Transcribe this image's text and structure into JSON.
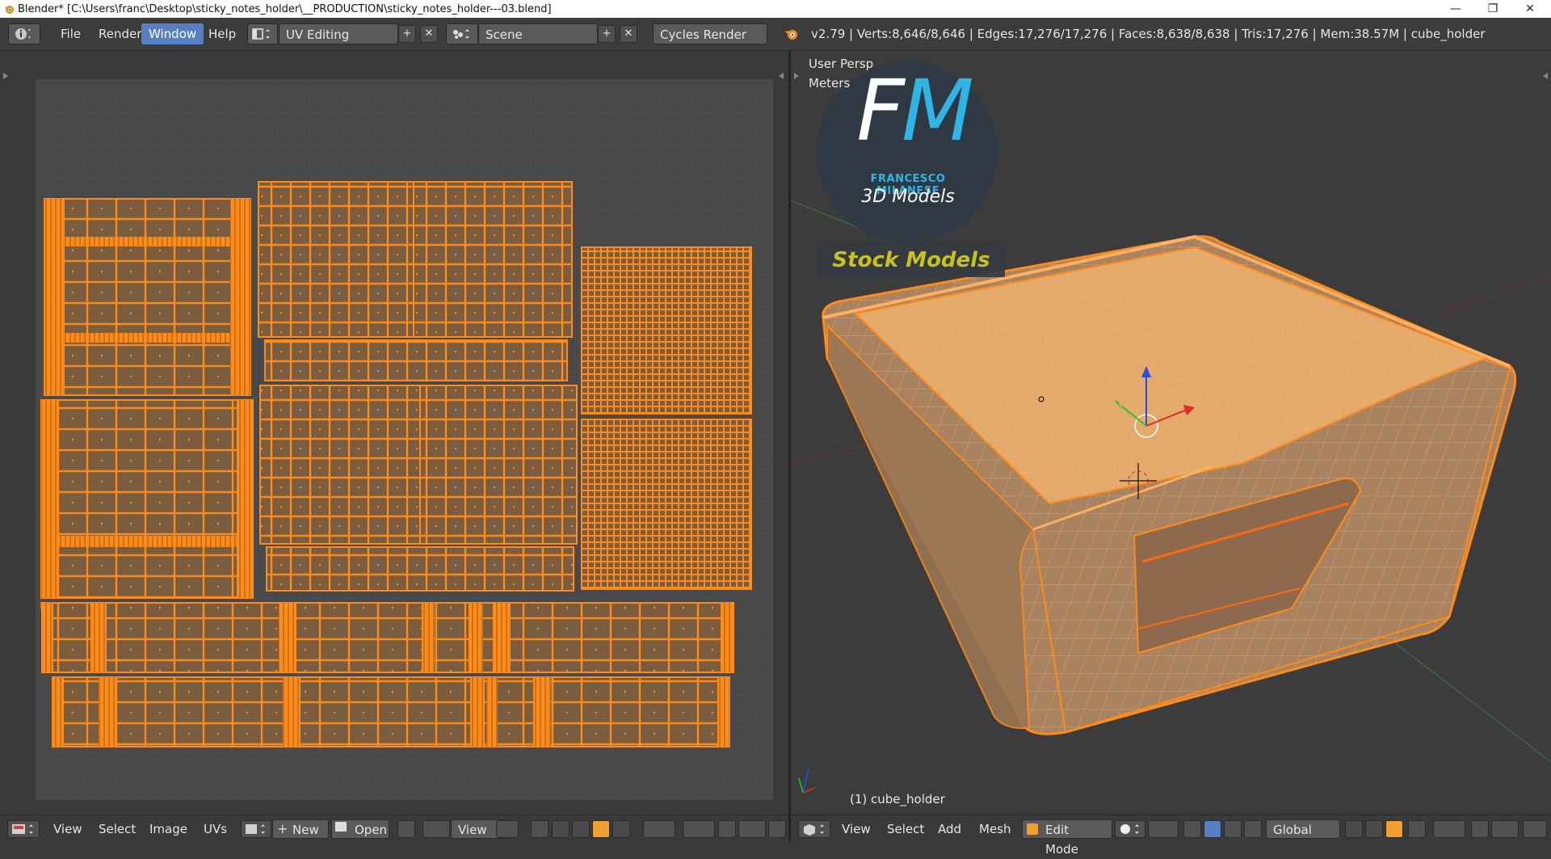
{
  "window": {
    "title": "Blender* [C:\\Users\\franc\\Desktop\\sticky_notes_holder\\__PRODUCTION\\sticky_notes_holder---03.blend]",
    "minimize": "—",
    "maximize": "❐",
    "close": "✕"
  },
  "topbar": {
    "menu": [
      "File",
      "Render",
      "Window",
      "Help"
    ],
    "active_menu": "Window",
    "screen_layout": "UV Editing",
    "scene": "Scene",
    "render_engine": "Cycles Render",
    "stats": "v2.79 | Verts:8,646/8,646 | Edges:17,276/17,276 | Faces:8,638/8,638 | Tris:17,276 | Mem:38.57M | cube_holder"
  },
  "uv_editor": {
    "menu": [
      "View",
      "Select",
      "Image",
      "UVs"
    ],
    "new_label": "New",
    "open_label": "Open",
    "view_label": "View"
  },
  "viewport": {
    "view_name": "User Persp",
    "units": "Meters",
    "object_label": "(1) cube_holder",
    "menu": [
      "View",
      "Select",
      "Add",
      "Mesh"
    ],
    "mode": "Edit Mode",
    "orientation": "Global",
    "logo": {
      "letters": "FM",
      "name": "FRANCESCO MILANESE",
      "subtitle": "3D Models",
      "banner": "Stock Models"
    }
  },
  "colors": {
    "accent": "#ff8b1a",
    "active_menu": "#5680c2",
    "uv_bg": "#4a4a4a",
    "island_fill": "#7a5c3e",
    "logo_cyan": "#2fb4e6",
    "banner_text": "#c8c21c"
  }
}
